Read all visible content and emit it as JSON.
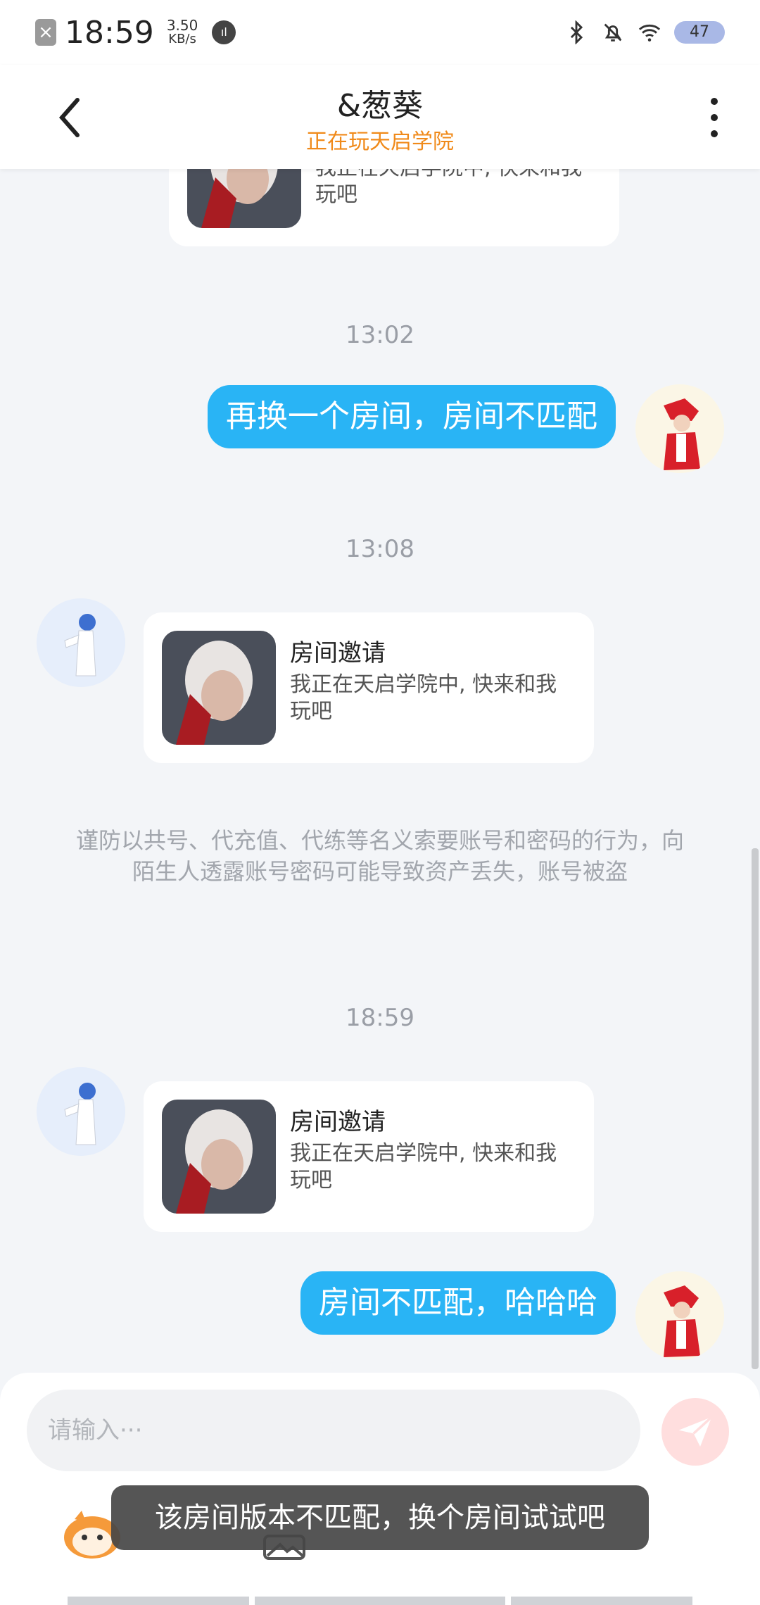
{
  "status_bar": {
    "time": "18:59",
    "speed_value": "3.50",
    "speed_unit": "KB/s",
    "battery": "47"
  },
  "header": {
    "title": "&葱葵",
    "subtitle": "正在玩天启学院"
  },
  "messages": {
    "top_card": {
      "desc": "我正在天启学院中, 快来和我玩吧"
    },
    "ts1": "13:02",
    "bubble1": "再换一个房间，房间不匹配",
    "ts2": "13:08",
    "card1": {
      "title": "房间邀请",
      "desc": "我正在天启学院中, 快来和我玩吧"
    },
    "notice": "谨防以共号、代充值、代练等名义索要账号和密码的行为，向陌生人透露账号密码可能导致资产丢失，账号被盗",
    "ts3": "18:59",
    "card2": {
      "title": "房间邀请",
      "desc": "我正在天启学院中, 快来和我玩吧"
    },
    "bubble2": "房间不匹配，哈哈哈"
  },
  "input": {
    "placeholder": "请输入···"
  },
  "toast": "该房间版本不匹配，换个房间试试吧",
  "colors": {
    "bubble": "#29b4f5",
    "subtitle": "#f08a1a",
    "background": "#f3f5f8"
  }
}
